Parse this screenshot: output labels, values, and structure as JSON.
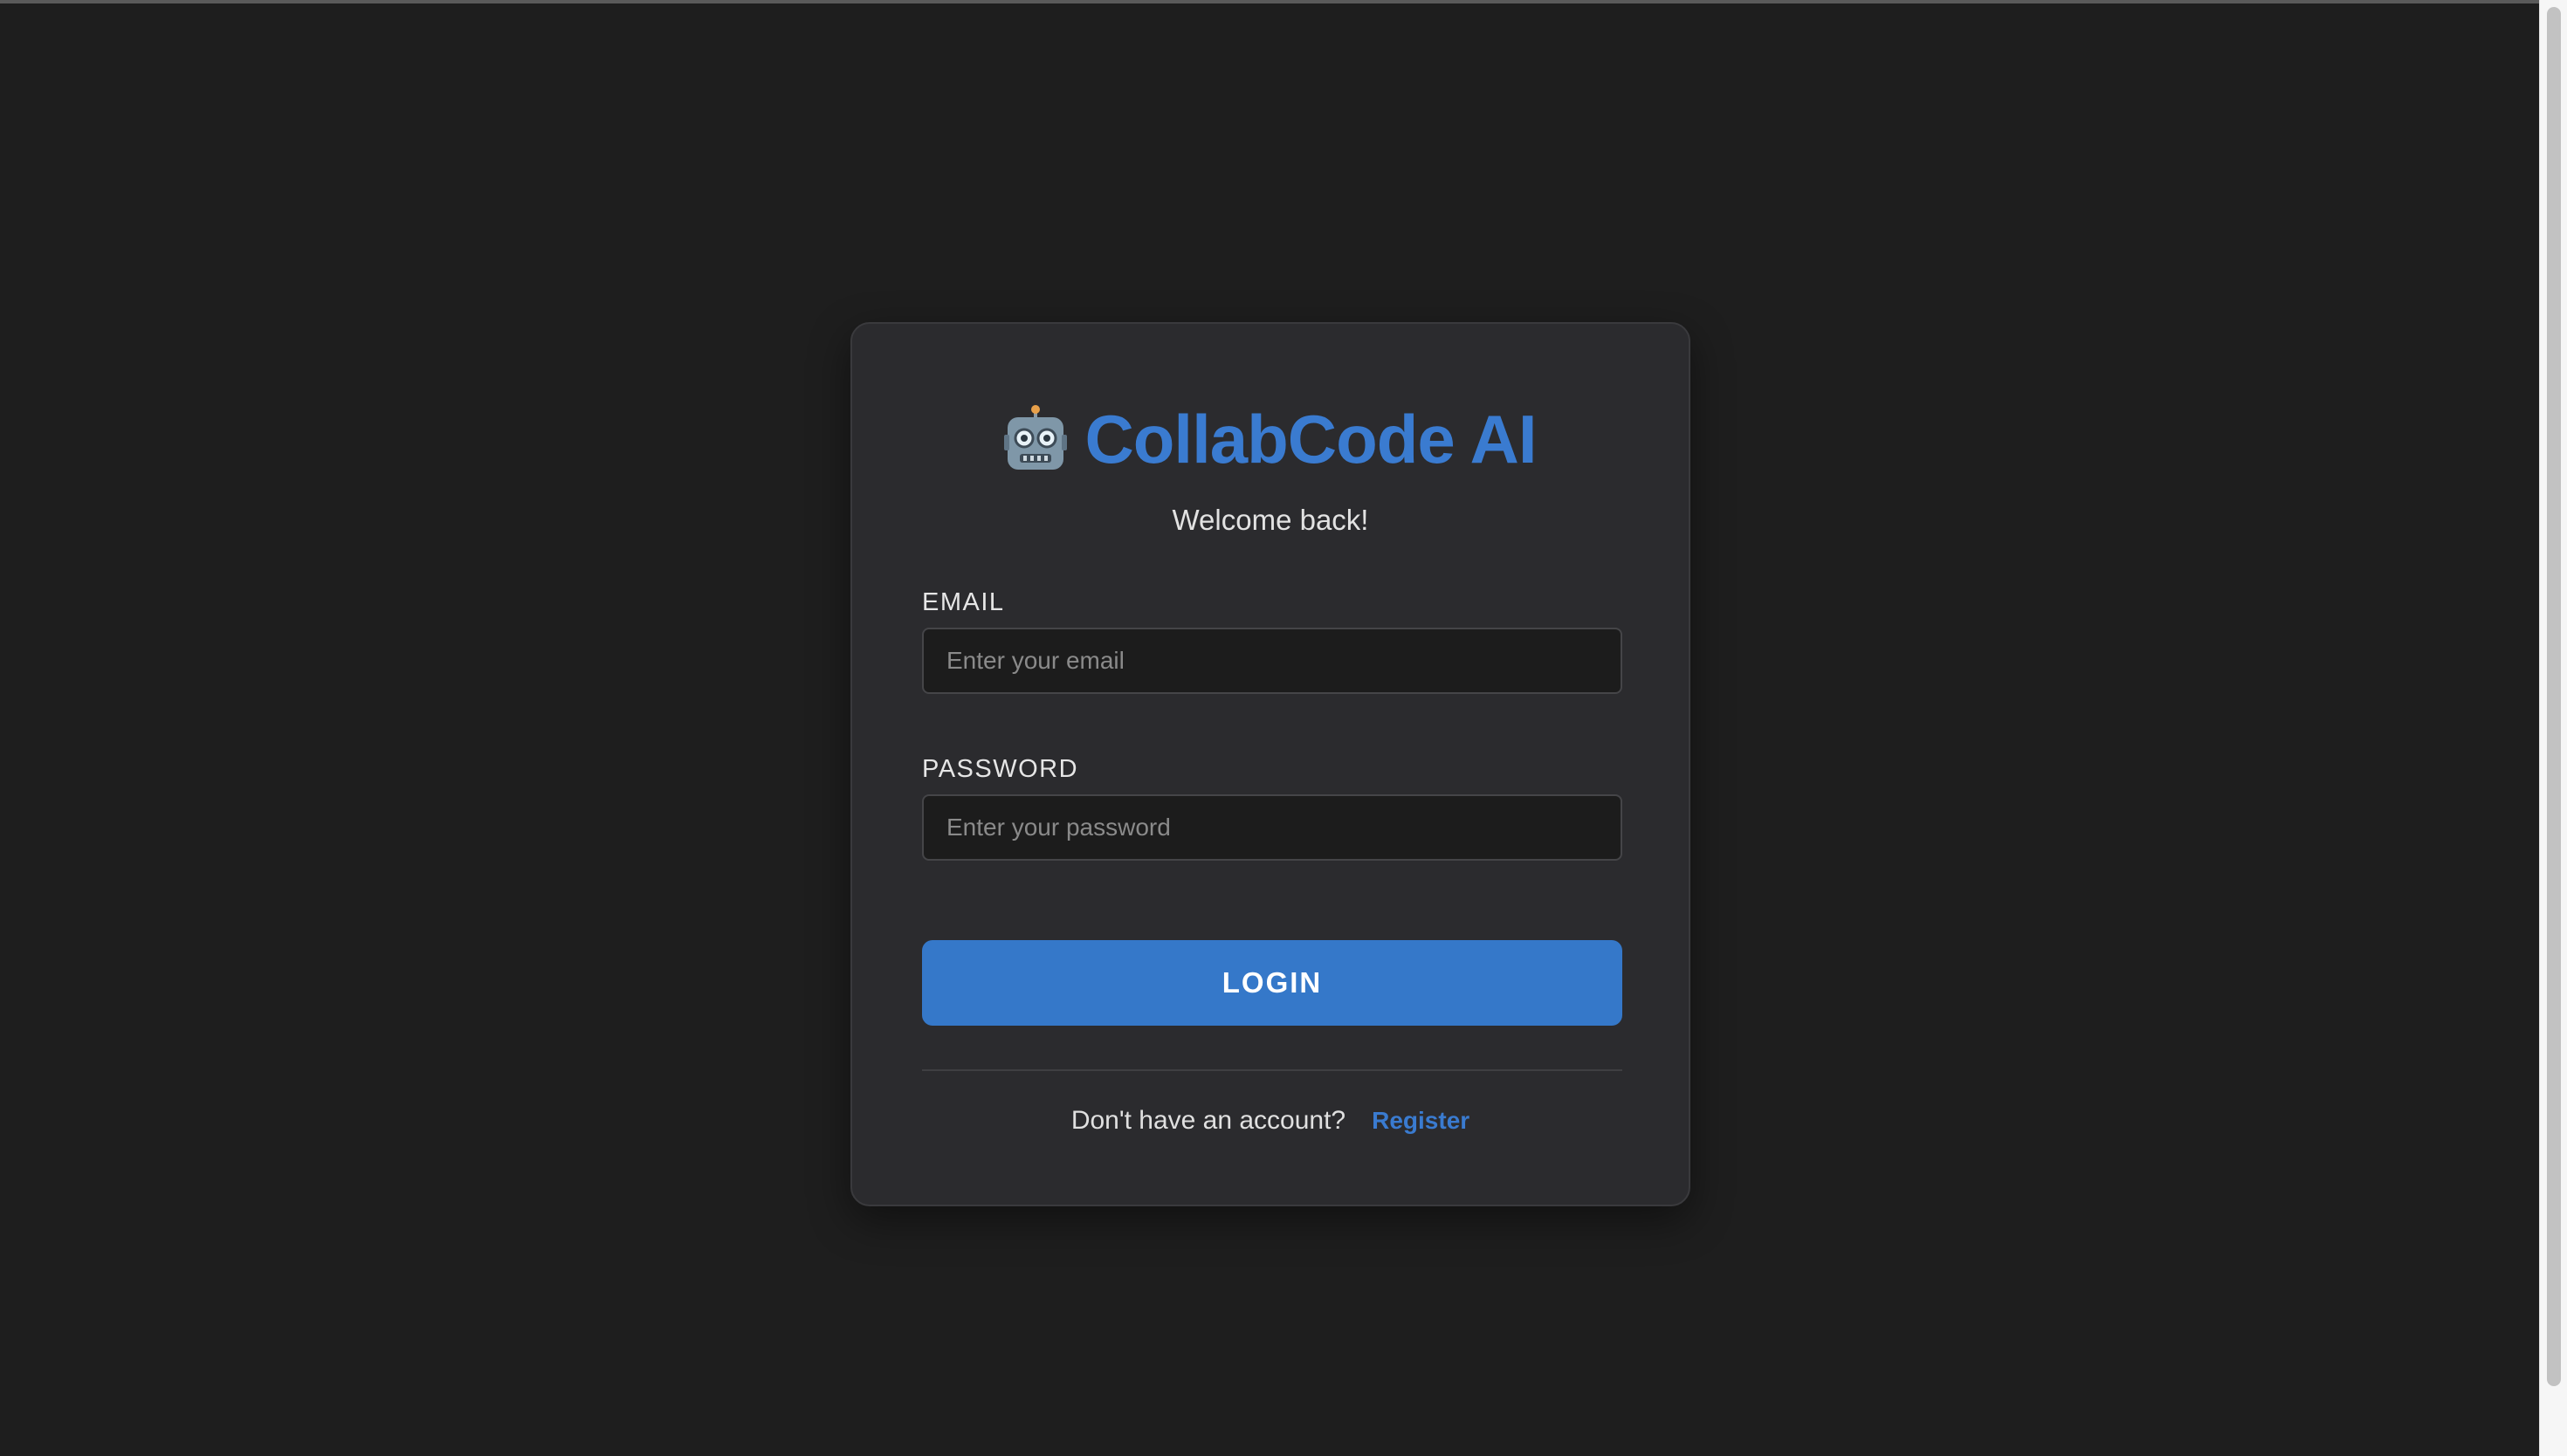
{
  "brand": {
    "title": "CollabCode AI",
    "icon": "robot-icon"
  },
  "subtitle": "Welcome back!",
  "form": {
    "email": {
      "label": "EMAIL",
      "placeholder": "Enter your email",
      "value": ""
    },
    "password": {
      "label": "PASSWORD",
      "placeholder": "Enter your password",
      "value": ""
    },
    "submit_label": "LOGIN"
  },
  "footer": {
    "prompt": "Don't have an account?",
    "link_label": "Register"
  },
  "colors": {
    "background": "#1e1e1e",
    "card": "#2b2b2e",
    "accent": "#3578c9",
    "input_background": "#1c1c1c"
  }
}
